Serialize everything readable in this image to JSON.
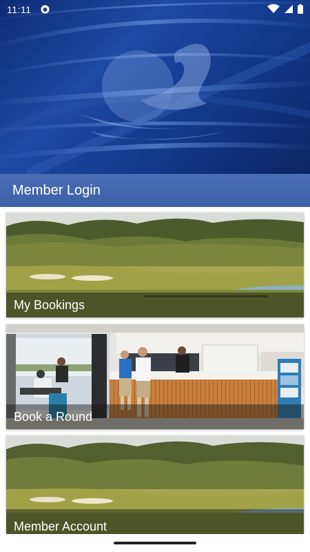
{
  "status_bar": {
    "time": "11:11",
    "icons": [
      "notification-icon",
      "wifi-icon",
      "signal-icon",
      "battery-icon"
    ]
  },
  "hero": {
    "logo_icon": "swan-golf-logo"
  },
  "login_bar": {
    "label": "Member Login"
  },
  "cards": [
    {
      "label": "My Bookings",
      "image": "golf-course-landscape"
    },
    {
      "label": "Book a Round",
      "image": "clubhouse-bar-interior"
    },
    {
      "label": "Member Account",
      "image": "golf-course-landscape"
    }
  ],
  "colors": {
    "hero_blue": "#1d4aa4",
    "login_bar": "#4a6db3",
    "text_light": "#ffffff"
  }
}
